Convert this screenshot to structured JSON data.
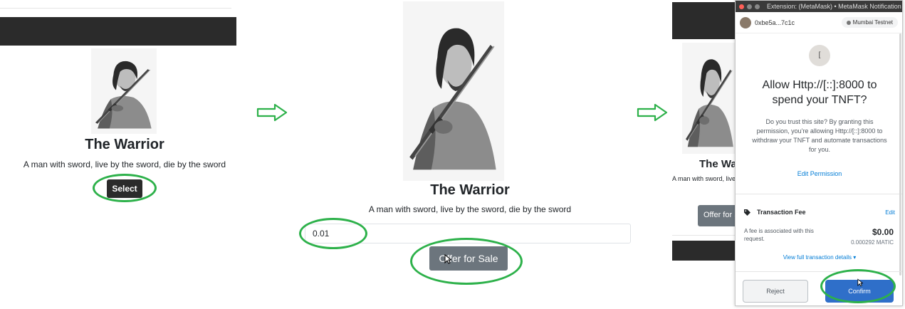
{
  "panel1": {
    "nft_title": "The Warrior",
    "nft_description": "A man with sword, live by the sword, die by the sword",
    "select_label": "Select"
  },
  "panel2": {
    "nft_title": "The Warrior",
    "nft_description": "A man with sword, live by the sword, die by the sword",
    "price_value": "0.01",
    "offer_label": "Offer for Sale"
  },
  "panel3": {
    "background": {
      "nft_title": "The Warrior",
      "nft_description": "A man with sword, live by the sword, die by the sword",
      "offer_label": "Offer for Sale"
    },
    "metamask": {
      "window_title": "Extension: (MetaMask) • MetaMask Notification",
      "account_address": "0xbe5a...7c1c",
      "network": "Mumbai Testnet",
      "site_initial": "[",
      "heading": "Allow Http://[::]:8000 to spend your TNFT?",
      "body": "Do you trust this site? By granting this permission, you're allowing Http://[::]:8000 to withdraw your TNFT and automate transactions for you.",
      "edit_permission": "Edit Permission",
      "fee_label": "Transaction Fee",
      "fee_edit": "Edit",
      "fee_description": "A fee is associated with this request.",
      "fee_usd": "$0.00",
      "fee_matic": "0.000292 MATIC",
      "view_details": "View full transaction details",
      "reject_label": "Reject",
      "confirm_label": "Confirm"
    }
  },
  "colors": {
    "highlight": "#2db14a",
    "navbar": "#2b2b2b",
    "offer_button": "#6c757d",
    "confirm_button": "#2f6fc9",
    "link": "#037dd6"
  },
  "icons": [
    "arrow-right-icon",
    "tag-icon",
    "network-icon",
    "chevron-down-icon",
    "cursor-icon"
  ]
}
